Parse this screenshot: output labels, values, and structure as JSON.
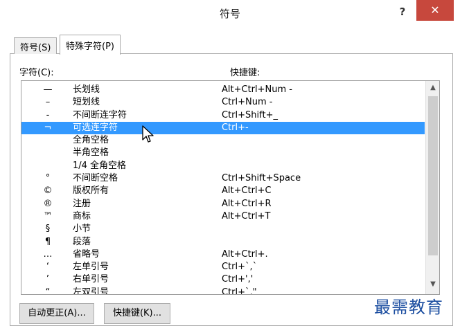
{
  "window": {
    "title": "符号",
    "help_label": "?",
    "close_label": "✕"
  },
  "tabs": [
    {
      "label": "符号(S)"
    },
    {
      "label": "特殊字符(P)"
    }
  ],
  "labels": {
    "characters": "字符(C):",
    "shortcut_keys": "快捷键:"
  },
  "list": {
    "rows": [
      {
        "symbol": "—",
        "name": "长划线",
        "key": "Alt+Ctrl+Num -"
      },
      {
        "symbol": "–",
        "name": "短划线",
        "key": "Ctrl+Num -"
      },
      {
        "symbol": "-",
        "name": "不间断连字符",
        "key": "Ctrl+Shift+_"
      },
      {
        "symbol": "¬",
        "name": "可选连字符",
        "key": "Ctrl+-",
        "selected": true
      },
      {
        "symbol": "",
        "name": "全角空格",
        "key": ""
      },
      {
        "symbol": "",
        "name": "半角空格",
        "key": ""
      },
      {
        "symbol": "",
        "name": "1/4 全角空格",
        "key": ""
      },
      {
        "symbol": "°",
        "name": "不间断空格",
        "key": "Ctrl+Shift+Space"
      },
      {
        "symbol": "©",
        "name": "版权所有",
        "key": "Alt+Ctrl+C"
      },
      {
        "symbol": "®",
        "name": "注册",
        "key": "Alt+Ctrl+R"
      },
      {
        "symbol": "™",
        "name": "商标",
        "key": "Alt+Ctrl+T"
      },
      {
        "symbol": "§",
        "name": "小节",
        "key": ""
      },
      {
        "symbol": "¶",
        "name": "段落",
        "key": ""
      },
      {
        "symbol": "…",
        "name": "省略号",
        "key": "Alt+Ctrl+."
      },
      {
        "symbol": "‘",
        "name": "左单引号",
        "key": "Ctrl+`,`"
      },
      {
        "symbol": "’",
        "name": "右单引号",
        "key": "Ctrl+','"
      },
      {
        "symbol": "“",
        "name": "左双引号",
        "key": "Ctrl+`,\""
      }
    ]
  },
  "scrollbar": {
    "up_glyph": "▲",
    "down_glyph": "▼"
  },
  "buttons": {
    "autocorrect": "自动更正(A)...",
    "shortcut": "快捷键(K)..."
  },
  "watermark": "最需教育",
  "colors": {
    "selection": "#3399ff",
    "close_button": "#c7483d"
  }
}
